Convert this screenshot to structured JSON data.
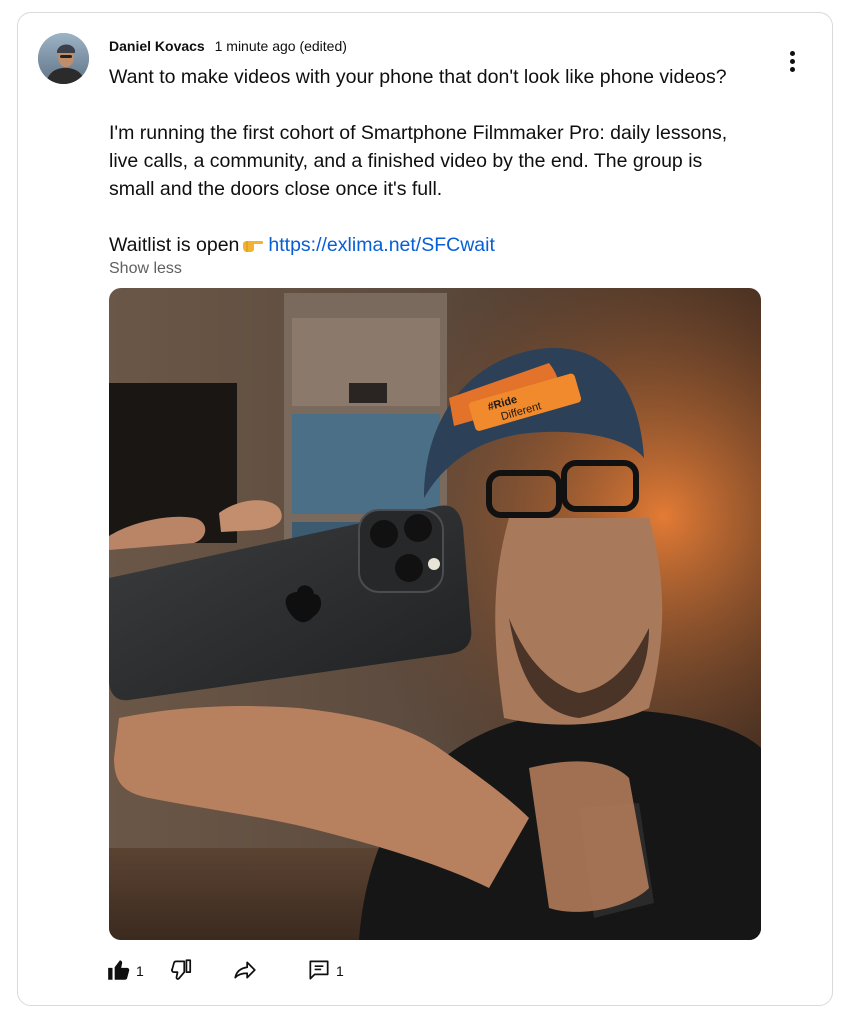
{
  "post": {
    "author": "Daniel Kovacs",
    "time": "1 minute ago (edited)",
    "lines": [
      "Want to make videos with your phone that don't look like phone videos?",
      "I'm running the first cohort of Smartphone Filmmaker Pro: daily lessons,",
      "live calls, a community, and a finished video by the end. The group is",
      "small and the doors close once it's full.",
      "Waitlist is open"
    ],
    "link": "https://exlima.net/SFCwait",
    "show_less": "Show less",
    "cap_text": [
      "#Ride",
      "Different"
    ]
  },
  "actions": {
    "like_count": "1",
    "comment_count": "1"
  },
  "colors": {
    "link": "#065fd4",
    "secondary_text": "#606060",
    "border": "#d9d9d9"
  },
  "icons": {
    "more": "vertical-ellipsis-icon",
    "like": "thumbs-up-icon",
    "dislike": "thumbs-down-icon",
    "share": "share-arrow-icon",
    "comment": "comment-icon",
    "pointing": "pointing-hand-emoji"
  }
}
